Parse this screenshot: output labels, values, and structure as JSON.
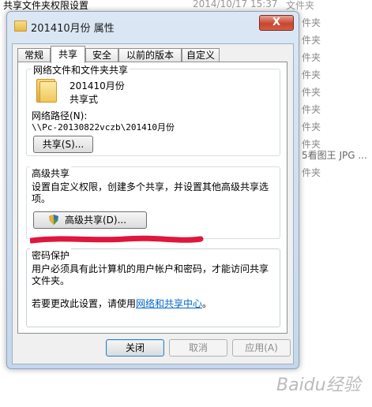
{
  "background": {
    "title": "共享文件夹权限设置",
    "date": "2014/10/17 15:37",
    "type_label": "文件夹",
    "fragments": [
      "件夹",
      "件夹",
      "件夹",
      "件夹",
      "件夹",
      "件夹",
      "5看图王 JPG ..."
    ],
    "right_edge": [
      "件夹",
      "件夹",
      "件夹"
    ],
    "watermark": "Baidu经验"
  },
  "dialog": {
    "title": "201410月份 属性",
    "close_label": "X",
    "tabs": [
      "常规",
      "共享",
      "安全",
      "以前的版本",
      "自定义"
    ],
    "network_share": {
      "group_title": "网络文件和文件夹共享",
      "folder_name": "201410月份",
      "status": "共享式",
      "path_label": "网络路径(N):",
      "path_value": "\\\\Pc-20130822vczb\\201410月份",
      "share_button": "共享(S)..."
    },
    "advanced_share": {
      "group_title": "高级共享",
      "description": "设置自定义权限，创建多个共享，并设置其他高级共享选项。",
      "button": "高级共享(D)..."
    },
    "password": {
      "group_title": "密码保护",
      "description": "用户必须具有此计算机的用户帐户和密码，才能访问共享文件夹。",
      "change_text_prefix": "若要更改此设置，请使用",
      "link_text": "网络和共享中心",
      "change_text_suffix": "。"
    },
    "footer": {
      "close": "关闭",
      "cancel": "取消",
      "apply": "应用(A)"
    }
  }
}
